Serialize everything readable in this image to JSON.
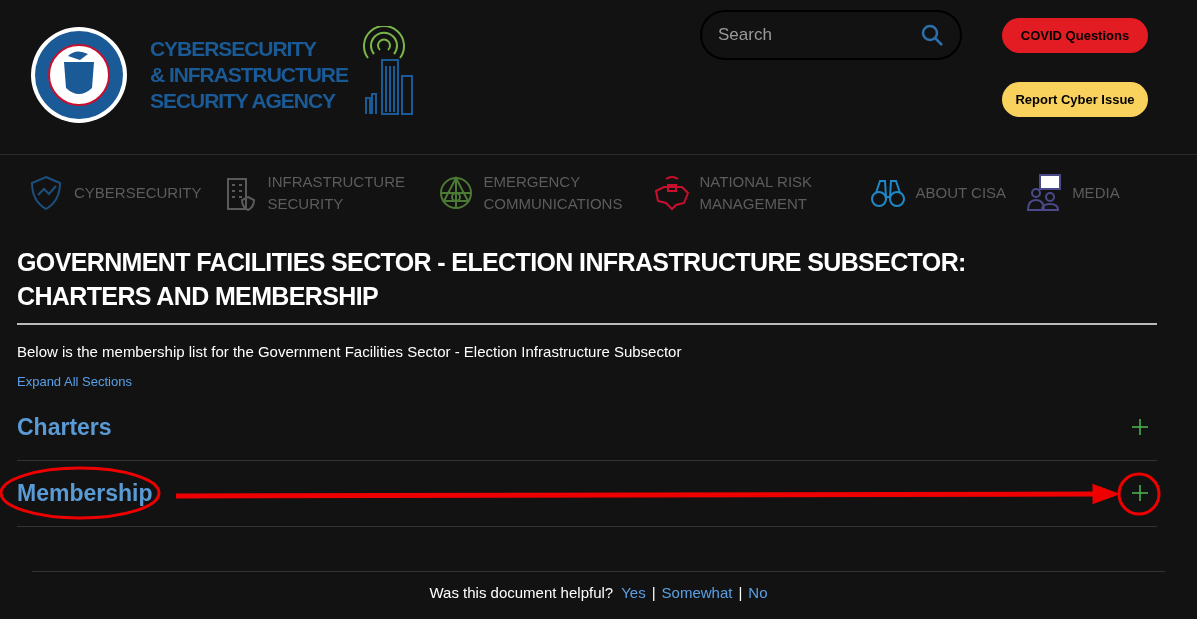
{
  "logo": {
    "title_lines": [
      "CYBERSECURITY",
      "& INFRASTRUCTURE",
      "SECURITY AGENCY"
    ]
  },
  "search": {
    "placeholder": "Search"
  },
  "header_buttons": [
    {
      "label": "COVID Questions",
      "color": "#e31c23"
    },
    {
      "label": "Report Cyber Issue",
      "color": "#f9d25e"
    }
  ],
  "nav": [
    {
      "label": "CYBERSECURITY",
      "kind": "shield",
      "color": "#1d4f7a"
    },
    {
      "label": "INFRASTRUCTURE SECURITY",
      "kind": "building",
      "color": "#5a5a5a"
    },
    {
      "label": "EMERGENCY COMMUNICATIONS",
      "kind": "network",
      "color": "#4c7a34"
    },
    {
      "label": "NATIONAL RISK MANAGEMENT",
      "kind": "map",
      "color": "#c8102e"
    },
    {
      "label": "ABOUT CISA",
      "kind": "binoculars",
      "color": "#1e88c8"
    },
    {
      "label": "MEDIA",
      "kind": "people",
      "color": "#4a4a8a"
    }
  ],
  "page": {
    "title": "GOVERNMENT FACILITIES SECTOR - ELECTION INFRASTRUCTURE SUBSECTOR: CHARTERS AND MEMBERSHIP",
    "intro": "Below is the membership list for the Government Facilities Sector - Election Infrastructure Subsector",
    "expand_all": "Expand All Sections",
    "sections": [
      {
        "title": "Charters",
        "expanded": false,
        "highlighted": false
      },
      {
        "title": "Membership",
        "expanded": false,
        "highlighted": true
      }
    ]
  },
  "feedback": {
    "question": "Was this document helpful?",
    "options": [
      "Yes",
      "Somewhat",
      "No"
    ],
    "separator": "|"
  }
}
